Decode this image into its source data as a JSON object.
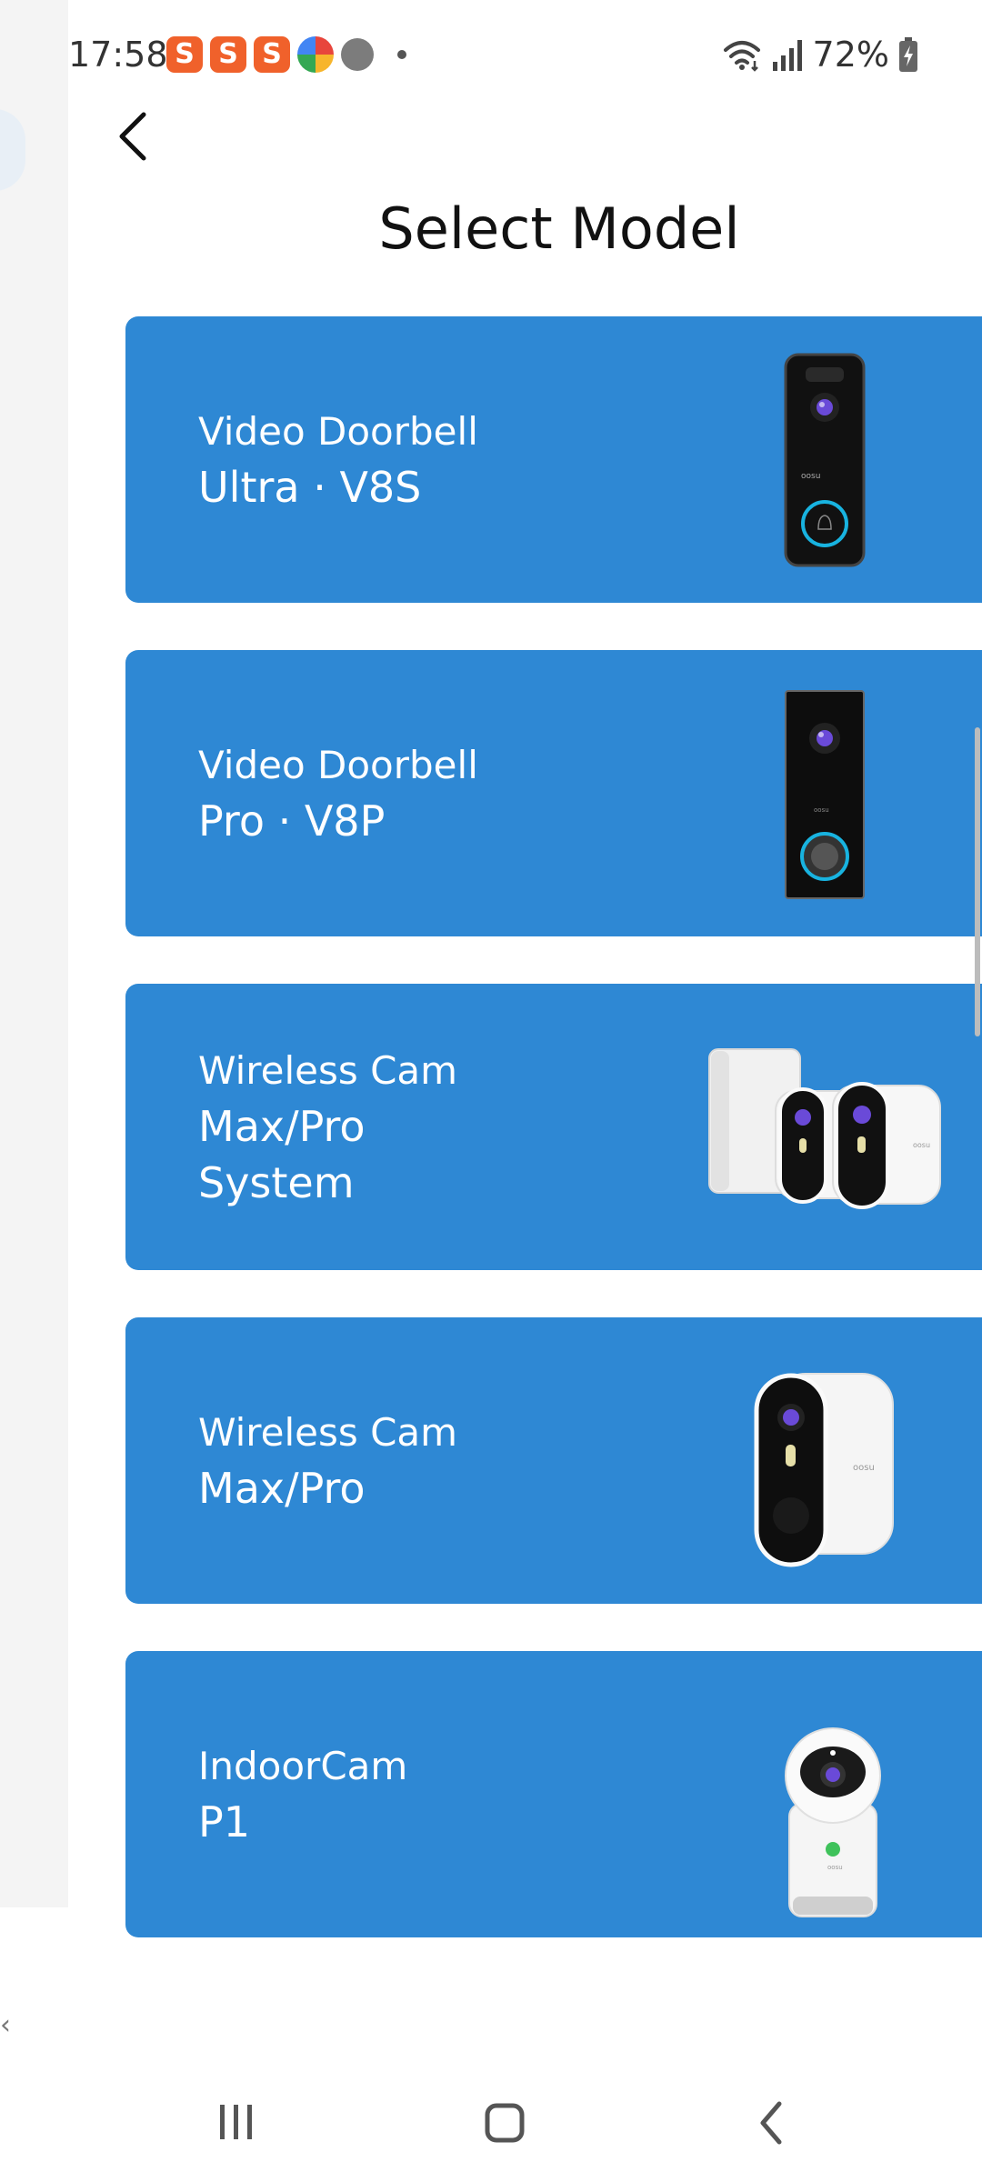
{
  "status_bar": {
    "time": "17:58",
    "notification_icons": [
      "s-app-icon",
      "s-app-icon",
      "s-app-icon",
      "colorful-app-icon",
      "gray-app-icon",
      "more-dot-icon"
    ],
    "battery_text": "72%"
  },
  "header": {
    "title": "Select Model",
    "back_icon": "chevron-left-icon"
  },
  "models": [
    {
      "line1": "Video Doorbell",
      "line2": "Ultra · V8S",
      "image_icon": "doorbell-ultra-image"
    },
    {
      "line1": "Video Doorbell",
      "line2": "Pro · V8P",
      "image_icon": "doorbell-pro-image"
    },
    {
      "line1": "Wireless Cam",
      "line2": "Max/Pro",
      "line3": "System",
      "image_icon": "camera-system-image"
    },
    {
      "line1": "Wireless Cam",
      "line2": "Max/Pro",
      "image_icon": "wireless-camera-image"
    },
    {
      "line1": "IndoorCam",
      "line2": "P1",
      "image_icon": "indoor-camera-image"
    }
  ],
  "brand_text": "oosu",
  "colors": {
    "card_blue": "#2e88d4",
    "ring_cyan": "#18b3e0",
    "lens_purple": "#6a4ad8"
  },
  "nav_bar": {
    "recent_icon": "recent-apps-icon",
    "home_icon": "home-icon",
    "back_icon": "back-icon"
  }
}
